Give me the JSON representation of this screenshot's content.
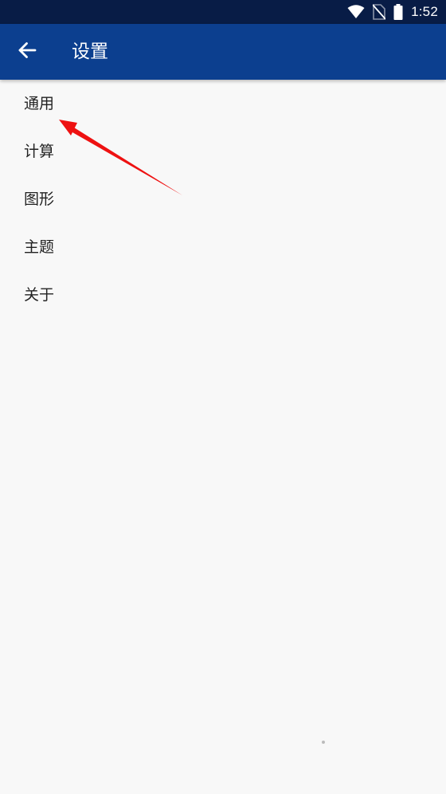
{
  "status_bar": {
    "time": "1:52",
    "icons": [
      "wifi-icon",
      "no-sim-icon",
      "battery-icon"
    ]
  },
  "app_bar": {
    "title": "设置",
    "back_icon": "arrow-left-icon"
  },
  "settings": {
    "items": [
      {
        "label": "通用"
      },
      {
        "label": "计算"
      },
      {
        "label": "图形"
      },
      {
        "label": "主题"
      },
      {
        "label": "关于"
      }
    ]
  },
  "colors": {
    "status_bar_bg": "#081c46",
    "app_bar_bg": "#0c3f8f",
    "page_bg": "#f8f8f8",
    "annotation_arrow": "#ee1111"
  }
}
